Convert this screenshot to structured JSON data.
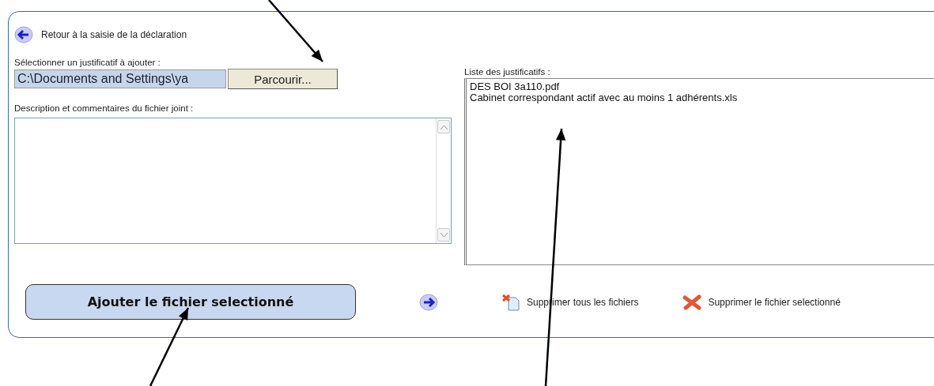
{
  "back_link": {
    "label": "Retour à la saisie de la déclaration"
  },
  "file_picker": {
    "label": "Sélectionner un justificatif à ajouter :",
    "value": "C:\\Documents and Settings\\ya",
    "browse_button": "Parcourir..."
  },
  "description": {
    "label": "Description et commentaires du fichier joint :"
  },
  "attachments": {
    "label": "Liste des justificatifs :",
    "items": [
      {
        "name": "DES BOI 3a110.pdf"
      },
      {
        "name": "Cabinet correspondant actif avec au moins 1 adhérents.xls"
      }
    ]
  },
  "add_button": {
    "label": "Ajouter le fichier selectionné"
  },
  "actions": [
    {
      "kind": "delete-all",
      "label": "Supprimer tous les fichiers"
    },
    {
      "kind": "delete-one",
      "label": "Supprimer le fichier selectionné"
    }
  ],
  "annotation_arrows": [
    {
      "kind": "down"
    },
    {
      "kind": "up"
    },
    {
      "kind": "up-long"
    }
  ]
}
